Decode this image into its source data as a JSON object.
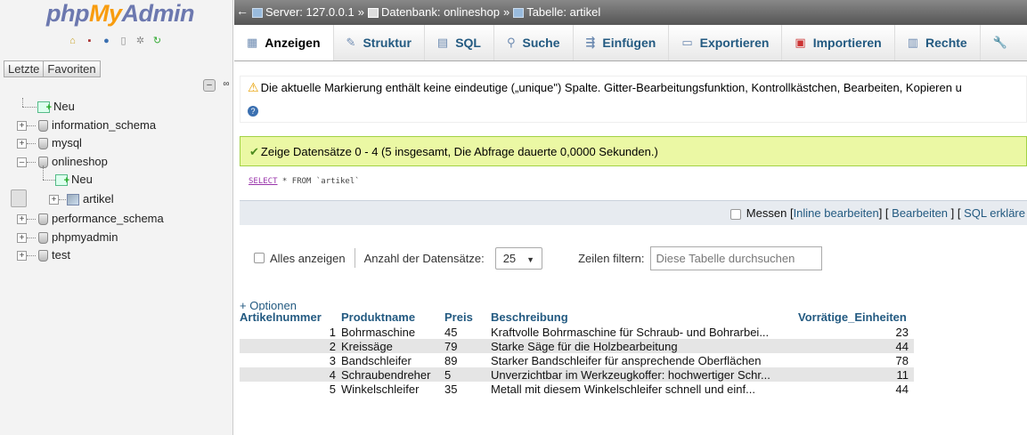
{
  "logo": {
    "php": "php",
    "my": "My",
    "admin": "Admin"
  },
  "nav": {
    "tabs": [
      "Letzte",
      "Favoriten"
    ],
    "collapse_label": "–",
    "link_label": "∞",
    "tree": [
      {
        "label": "Neu"
      },
      {
        "label": "information_schema"
      },
      {
        "label": "mysql"
      },
      {
        "label": "onlineshop"
      },
      {
        "label": "Neu"
      },
      {
        "label": "artikel"
      },
      {
        "label": "performance_schema"
      },
      {
        "label": "phpmyadmin"
      },
      {
        "label": "test"
      }
    ]
  },
  "breadcrumb": {
    "server": "Server: 127.0.0.1",
    "database": "Datenbank: onlineshop",
    "table": "Tabelle: artikel",
    "separator": "»"
  },
  "tabs": [
    {
      "label": "Anzeigen",
      "icon": "▦"
    },
    {
      "label": "Struktur",
      "icon": "✎"
    },
    {
      "label": "SQL",
      "icon": "▤"
    },
    {
      "label": "Suche",
      "icon": "⚲"
    },
    {
      "label": "Einfügen",
      "icon": "⇶"
    },
    {
      "label": "Exportieren",
      "icon": "▭"
    },
    {
      "label": "Importieren",
      "icon": "▣"
    },
    {
      "label": "Rechte",
      "icon": "▥"
    },
    {
      "label": "",
      "icon": "🔧"
    }
  ],
  "notice": {
    "text": "Die aktuelle Markierung enthält keine eindeutige („unique\") Spalte. Gitter-Bearbeitungsfunktion, Kontrollkästchen, Bearbeiten, Kopieren u",
    "help": "?"
  },
  "success": {
    "text": "Zeige Datensätze 0 - 4 (5 insgesamt, Die Abfrage dauerte 0,0000 Sekunden.)"
  },
  "sql": {
    "keyword": "SELECT",
    "rest": " * FROM `artikel`"
  },
  "sqlbar": {
    "measure": "Messen",
    "inline_edit": "Inline bearbeiten",
    "edit": "Bearbeiten",
    "explain": "SQL erkläre"
  },
  "controls": {
    "show_all": "Alles anzeigen",
    "row_count_label": "Anzahl der Datensätze:",
    "row_count_value": "25",
    "filter_label": "Zeilen filtern:",
    "filter_placeholder": "Diese Tabelle durchsuchen"
  },
  "options_link": "+ Optionen",
  "table": {
    "headers": [
      "Artikelnummer",
      "Produktname",
      "Preis",
      "Beschreibung",
      "Vorrätige_Einheiten"
    ],
    "rows": [
      [
        "1",
        "Bohrmaschine",
        "45",
        "Kraftvolle Bohrmaschine für Schraub- und Bohrarbei...",
        "23"
      ],
      [
        "2",
        "Kreissäge",
        "79",
        "Starke Säge für die Holzbearbeitung",
        "44"
      ],
      [
        "3",
        "Bandschleifer",
        "89",
        "Starker Bandschleifer für ansprechende Oberflächen",
        "78"
      ],
      [
        "4",
        "Schraubendreher",
        "5",
        "Unverzichtbar im Werkzeugkoffer: hochwertiger Schr...",
        "11"
      ],
      [
        "5",
        "Winkelschleifer",
        "35",
        "Metall mit diesem Winkelschleifer schnell und einf...",
        "44"
      ]
    ]
  },
  "colors": {
    "link": "#235a81",
    "success_bg": "#ebf8a4",
    "logo_blue": "#6c78af",
    "logo_orange": "#f89c0e"
  }
}
